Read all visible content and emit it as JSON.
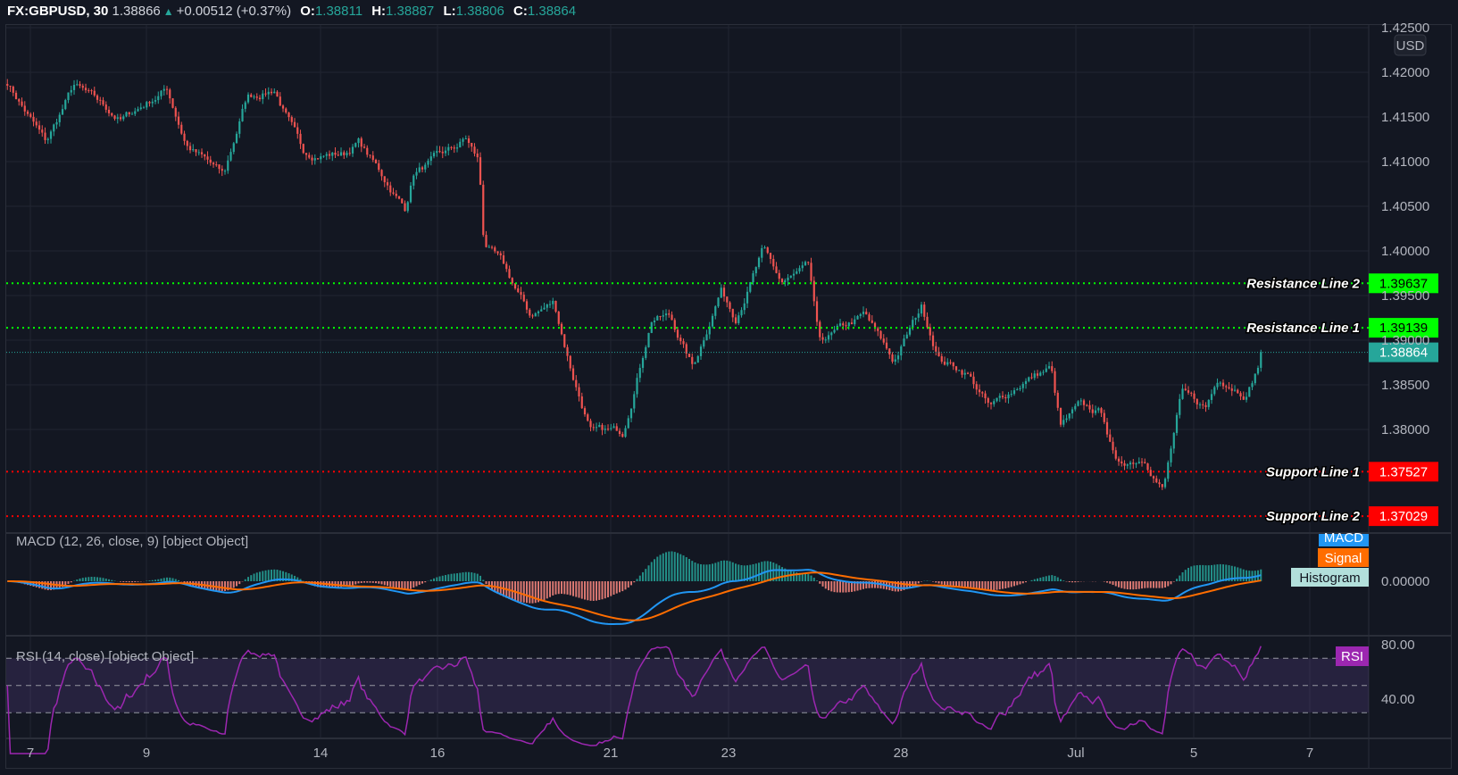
{
  "header": {
    "symbol": "FX:GBPUSD, 30",
    "last": "1.38866",
    "change": "+0.00512 (+0.37%)",
    "open_label": "O:",
    "open": "1.38811",
    "high_label": "H:",
    "high": "1.38887",
    "low_label": "L:",
    "low": "1.38806",
    "close_label": "C:",
    "close": "1.38864",
    "direction_icon": "triangle-up-icon"
  },
  "colors": {
    "background": "#131722",
    "grid": "#222631",
    "up": "#26a69a",
    "down": "#ef5350",
    "resistance": "#00ff00",
    "support": "#ff0000",
    "macd": "#2196f3",
    "signal": "#ff6d00",
    "histogram": "#b2dfdb",
    "rsi": "#9c27b0"
  },
  "chart_data": [
    {
      "type": "candlestick",
      "title": "FX:GBPUSD, 30",
      "currency": "USD",
      "price_ticks": [
        "1.42500",
        "1.42000",
        "1.41500",
        "1.41000",
        "1.40500",
        "1.40000",
        "1.39500",
        "1.39000",
        "1.38500",
        "1.38000"
      ],
      "x_ticks": [
        "7",
        "9",
        "14",
        "16",
        "21",
        "23",
        "28",
        "Jul",
        "5",
        "7"
      ],
      "grid": true,
      "last_price": "1.38864",
      "close_path": [
        [
          "06-06 14:30",
          1.4189
        ],
        [
          "06-07 06:30",
          1.412
        ],
        [
          "06-07 18:00",
          1.4185
        ],
        [
          "06-08 13:30",
          1.4146
        ],
        [
          "06-09 08:30",
          1.4182
        ],
        [
          "06-09 16:30",
          1.412
        ],
        [
          "06-10 08:00",
          1.4083
        ],
        [
          "06-10 17:30",
          1.4172
        ],
        [
          "06-11 05:00",
          1.4182
        ],
        [
          "06-11 16:30",
          1.4109
        ],
        [
          "06-14 10:00",
          1.4109
        ],
        [
          "06-14 15:30",
          1.4123
        ],
        [
          "06-15 11:00",
          1.4047
        ],
        [
          "06-15 14:30",
          1.4088
        ],
        [
          "06-16 08:00",
          1.4114
        ],
        [
          "06-16 12:00",
          1.4125
        ],
        [
          "06-16 17:30",
          1.4099
        ],
        [
          "06-16 19:30",
          1.401
        ],
        [
          "06-17 03:00",
          1.3984
        ],
        [
          "06-17 14:30",
          1.3927
        ],
        [
          "06-18 00:30",
          1.3942
        ],
        [
          "06-18 08:00",
          1.3864
        ],
        [
          "06-18 16:00",
          1.3796
        ],
        [
          "06-21 05:00",
          1.3796
        ],
        [
          "06-21 17:00",
          1.3927
        ],
        [
          "06-22 00:30",
          1.3927
        ],
        [
          "06-22 10:00",
          1.3869
        ],
        [
          "06-22 21:30",
          1.3958
        ],
        [
          "06-23 03:30",
          1.3927
        ],
        [
          "06-23 15:00",
          1.4
        ],
        [
          "06-23 22:30",
          1.3963
        ],
        [
          "06-24 10:00",
          1.3979
        ],
        [
          "06-24 14:00",
          1.3895
        ],
        [
          "06-25 09:00",
          1.3927
        ],
        [
          "06-25 21:00",
          1.3875
        ],
        [
          "06-28 08:30",
          1.3937
        ],
        [
          "06-28 16:00",
          1.388
        ],
        [
          "06-29 03:30",
          1.3864
        ],
        [
          "06-29 13:00",
          1.3823
        ],
        [
          "06-30 02:30",
          1.3854
        ],
        [
          "06-30 14:00",
          1.3869
        ],
        [
          "06-30 18:00",
          1.3802
        ],
        [
          "07-01 01:30",
          1.3823
        ],
        [
          "07-01 11:30",
          1.3817
        ],
        [
          "07-01 17:00",
          1.376
        ],
        [
          "07-02 05:00",
          1.377
        ],
        [
          "07-02 12:30",
          1.3734
        ],
        [
          "07-02 20:00",
          1.3838
        ],
        [
          "07-05 06:00",
          1.3823
        ],
        [
          "07-05 11:30",
          1.3859
        ],
        [
          "07-05 23:00",
          1.3843
        ],
        [
          "07-06 06:00",
          1.38866
        ]
      ],
      "horizontal_lines": [
        {
          "label": "Resistance Line 2",
          "value": "1.39637",
          "kind": "resistance"
        },
        {
          "label": "Resistance Line 1",
          "value": "1.39139",
          "kind": "resistance"
        },
        {
          "label": "Support Line 1",
          "value": "1.37527",
          "kind": "support"
        },
        {
          "label": "Support Line 2",
          "value": "1.37029",
          "kind": "support"
        }
      ]
    },
    {
      "type": "line",
      "title": "MACD (12, 26, close, 9) [object Object]",
      "y_ticks": [
        "0.00000"
      ],
      "legend": [
        "MACD",
        "Signal",
        "Histogram"
      ]
    },
    {
      "type": "line",
      "title": "RSI (14, close) [object Object]",
      "y_ticks": [
        "80.00",
        "40.00"
      ],
      "bands": [
        70,
        50,
        30
      ],
      "legend": [
        "RSI"
      ]
    }
  ]
}
